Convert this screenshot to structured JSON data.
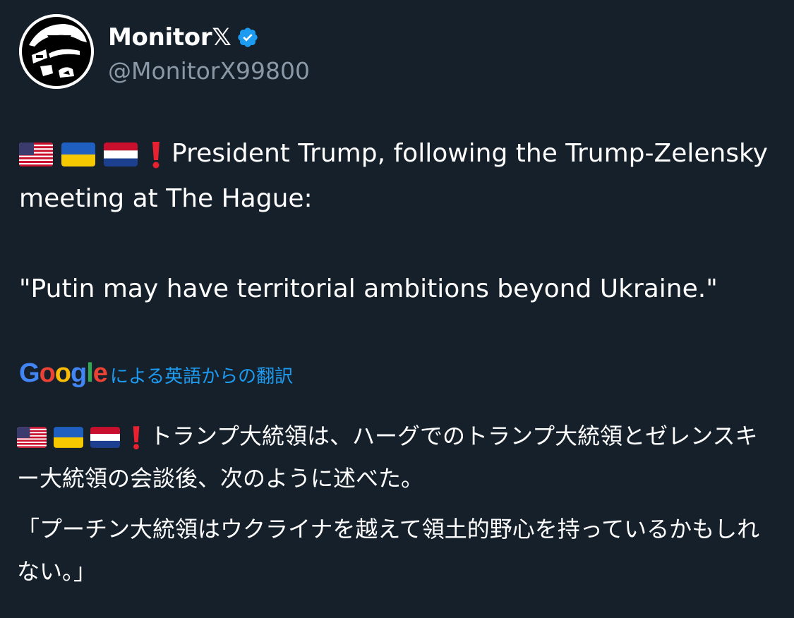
{
  "account": {
    "display_name": "Monitor𝕏",
    "handle": "@MonitorX99800",
    "avatar_icon": "hooded-figure-avatar",
    "verified_icon": "verified-badge-icon"
  },
  "tweet": {
    "lead_emojis": [
      "flag-us",
      "flag-ukraine",
      "flag-netherlands",
      "red-exclamation"
    ],
    "line1": "President Trump, following the Trump-Zelensky meeting at The Hague:",
    "quote": "\"Putin may have territorial ambitions beyond Ukraine.\""
  },
  "translation": {
    "provider": "Google",
    "label": "による英語からの翻訳",
    "text1": "トランプ大統領は、ハーグでのトランプ大統領とゼレンスキー大統領の会談後、次のように述べた。",
    "text2": "「プーチン大統領はウクライナを越えて領土的野心を持っているかもしれない。」"
  },
  "colors": {
    "background": "#15202b",
    "text": "#ffffff",
    "secondary_text": "#8b98a5",
    "accent": "#1d9bf0",
    "google_blue": "#4285F4",
    "google_red": "#EA4335",
    "google_yellow": "#FBBC05",
    "google_green": "#34A853"
  }
}
